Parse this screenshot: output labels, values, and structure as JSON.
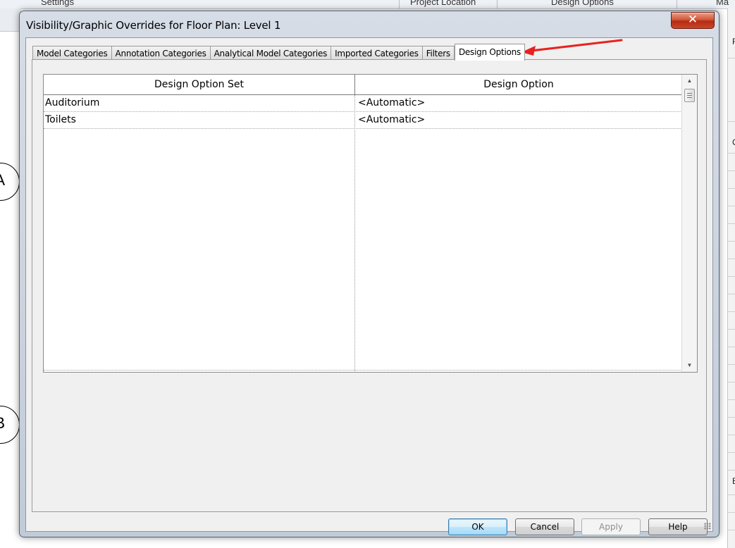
{
  "background": {
    "ribbon_labels": [
      "Settings",
      "Project Location",
      "Design Options",
      "Ma"
    ],
    "grid_bubbles": [
      "A",
      "B"
    ],
    "right_panel_letters": [
      "F",
      "C",
      "E"
    ]
  },
  "dialog": {
    "title": "Visibility/Graphic Overrides for Floor Plan: Level 1",
    "close_glyph": "✕"
  },
  "tabs": [
    {
      "label": "Model Categories",
      "active": false
    },
    {
      "label": "Annotation Categories",
      "active": false
    },
    {
      "label": "Analytical Model Categories",
      "active": false
    },
    {
      "label": "Imported Categories",
      "active": false
    },
    {
      "label": "Filters",
      "active": false
    },
    {
      "label": "Design Options",
      "active": true
    }
  ],
  "table": {
    "headers": [
      "Design Option Set",
      "Design Option"
    ],
    "rows": [
      {
        "set": "Auditorium",
        "option": "<Automatic>"
      },
      {
        "set": "Toilets",
        "option": "<Automatic>"
      }
    ]
  },
  "buttons": {
    "ok": "OK",
    "cancel": "Cancel",
    "apply": "Apply",
    "help": "Help"
  },
  "colors": {
    "annotation_arrow": "#e8231f",
    "close_button": "#c8472b"
  }
}
